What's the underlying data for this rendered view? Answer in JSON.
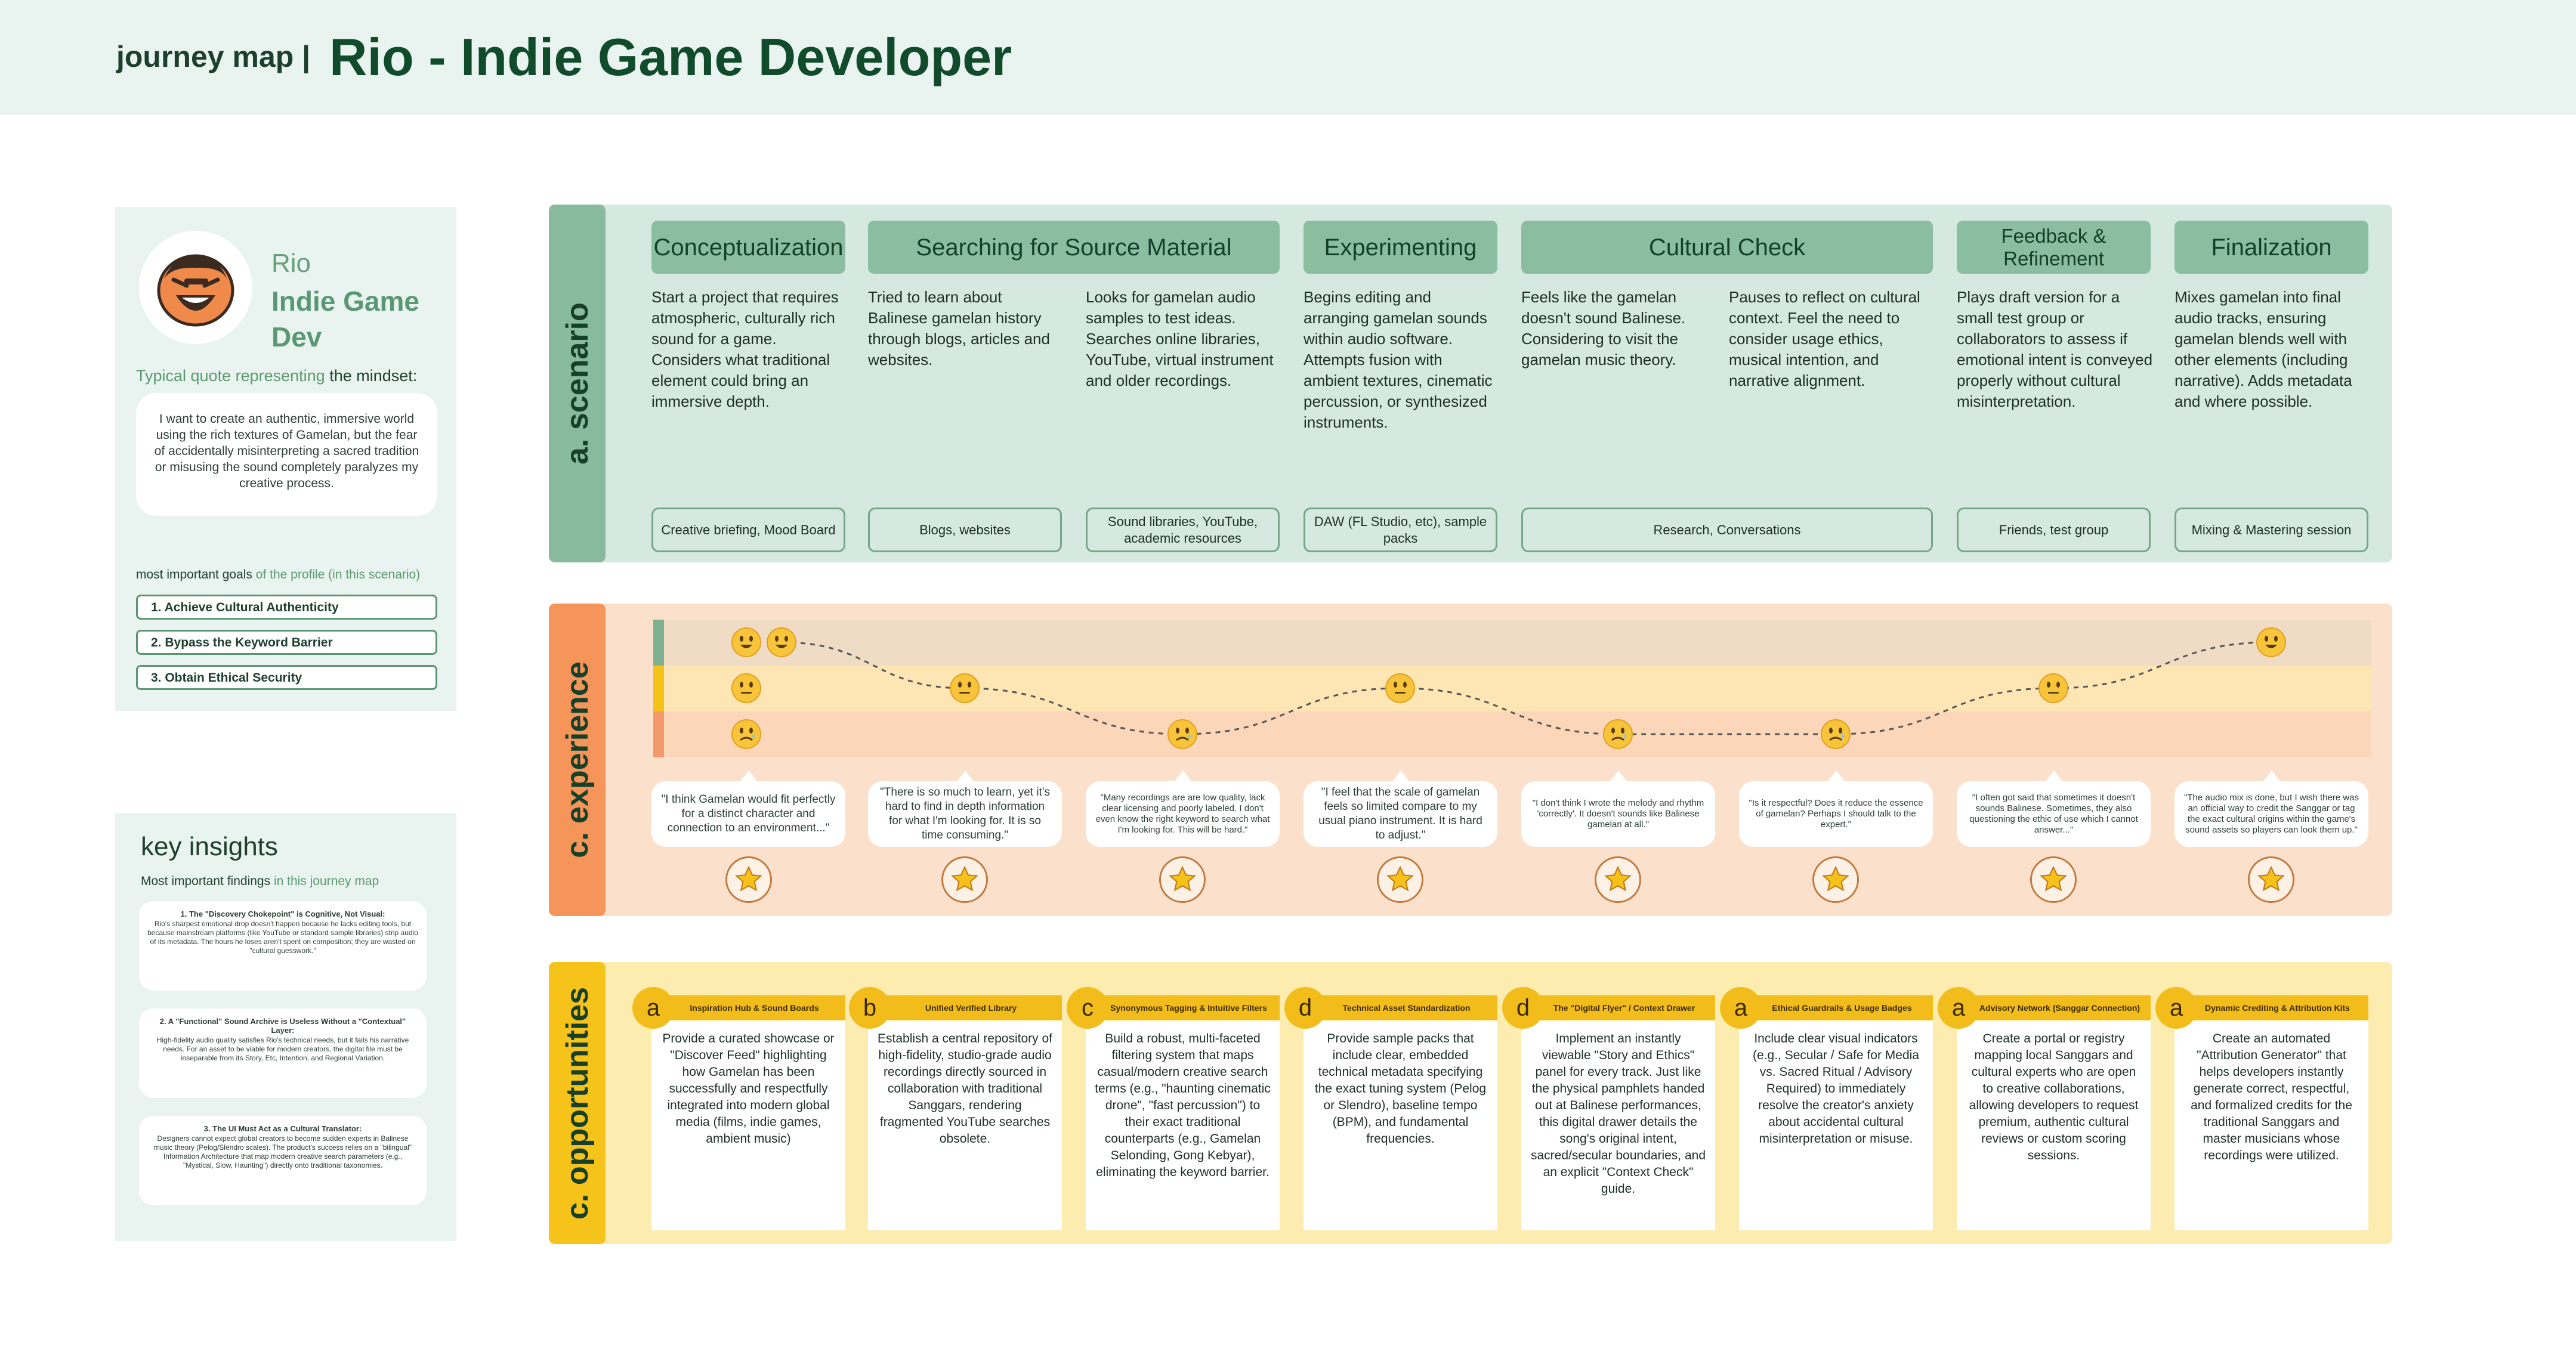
{
  "header": {
    "label": "journey map |",
    "title": "Rio - Indie Game Developer"
  },
  "persona": {
    "name": "Rio",
    "role": "Indie Game Dev",
    "quote_intro": "Typical quote representing",
    "quote_intro_b": "the mindset:",
    "quote": "I want to create an authentic, immersive world using the rich textures of Gamelan, but the fear of accidentally misinterpreting a sacred tradition or misusing the sound completely paralyzes my creative process.",
    "goals_intro": "most important goals",
    "goals_intro_b": "of the profile (in this scenario)",
    "goals": [
      "1. Achieve Cultural Authenticity",
      "2. Bypass the Keyword Barrier",
      "3. Obtain Ethical Security"
    ]
  },
  "insights": {
    "title": "key insights",
    "subtitle": "Most important findings",
    "subtitle_b": "in this journey map",
    "items": [
      {
        "heading": "1. The \"Discovery Chokepoint\" is Cognitive, Not Visual:",
        "body": "Rio's sharpest emotional drop doesn't happen because he lacks editing tools, but because mainstream platforms (like YouTube or standard sample libraries) strip audio of its metadata. The hours he loses aren't spent on composition; they are wasted on \"cultural guesswork.\""
      },
      {
        "heading": "2. A \"Functional\" Sound Archive is Useless Without a \"Contextual\" Layer:",
        "body": "High-fidelity audio quality satisfies Rio's technical needs, but it fails his narrative needs. For an asset to be viable for modern creators, the digital file must be inseparable from its Story, Etc, Intention, and Regional Variation."
      },
      {
        "heading": "3. The UI Must Act as a Cultural Translator:",
        "body": "Designers cannot expect global creators to become sudden experts in Balinese music theory (Pelog/Slendro scales). The product's success relies on a \"bilingual\" Information Architecture that map modern creative search parameters (e.g., \"Mystical, Slow, Haunting\") directly onto traditional taxonomies."
      }
    ]
  },
  "sections": {
    "scenario": "a. scenario",
    "experience": "c. experience",
    "opportunities": "c. opportunities"
  },
  "phases": [
    "Conceptualization",
    "Searching for Source Material",
    "Experimenting",
    "Cultural Check",
    "Feedback & Refinement",
    "Finalization"
  ],
  "scenario_texts": [
    "Start a project that requires atmospheric, culturally rich sound for a game. Considers what traditional element could bring an immersive depth.",
    "Tried to learn about Balinese gamelan history through blogs, articles and websites.",
    "Looks for gamelan audio samples to test ideas. Searches online libraries, YouTube, virtual instrument and older recordings.",
    "Begins editing and arranging gamelan sounds within audio software. Attempts fusion with ambient textures, cinematic percussion, or synthesized instruments.",
    "Feels like the gamelan doesn't sound Balinese. Considering to visit the gamelan music theory.",
    "Pauses to reflect on cultural context. Feel the need to consider usage ethics, musical intention, and narrative alignment.",
    "Plays draft version for a small test group or collaborators to assess if emotional intent is conveyed properly without cultural misinterpretation.",
    "Mixes gamelan into final audio tracks, ensuring gamelan blends well with other elements (including narrative). Adds metadata and where possible."
  ],
  "tools": [
    "Creative briefing, Mood Board",
    "Blogs, websites",
    "Sound libraries, YouTube, academic resources",
    "DAW (FL Studio, etc), sample packs",
    "Research, Conversations",
    "Friends, test group",
    "Mixing & Mastering session"
  ],
  "experience": {
    "levels": [
      3,
      2,
      1
    ],
    "points": [
      3,
      2,
      1,
      2,
      1,
      1,
      2,
      3
    ],
    "quotes": [
      "\"I think Gamelan would fit perfectly for a distinct character and connection to an environment...\"",
      "\"There is so much to learn, yet it's hard to find in depth information for what I'm looking for. It is so time consuming.\"",
      "\"Many recordings are are low quality, lack clear licensing and poorly labeled. I don't even know the right keyword to search what I'm looking for. This will be hard.\"",
      "\"I feel that the scale of gamelan feels so limited compare to my usual piano instrument. It is hard to adjust.\"",
      "\"I don't think I wrote the melody and rhythm 'correctly'. It doesn't sounds like Balinese gamelan at all.\"",
      "\"Is it respectful? Does it reduce the essence of gamelan? Perhaps I should talk to the expert.\"",
      "\"I often got said that sometimes it doesn't sounds Balinese. Sometimes, they also questioning the ethic of use which I cannot answer...\"",
      "\"The audio mix is done, but I wish there was an official way to credit the Sanggar or tag the exact cultural origins within the game's sound assets so players can look them up.\""
    ]
  },
  "opportunities": [
    {
      "badge": "a",
      "title": "Inspiration Hub & Sound Boards",
      "text": "Provide a curated showcase or \"Discover Feed\" highlighting how Gamelan has been successfully and respectfully integrated into modern global media (films, indie games, ambient music)"
    },
    {
      "badge": "b",
      "title": "Unified Verified Library",
      "text": "Establish a central repository of high-fidelity, studio-grade audio recordings directly sourced in collaboration with traditional Sanggars, rendering fragmented YouTube searches obsolete."
    },
    {
      "badge": "c",
      "title": "Synonymous Tagging & Intuitive Filters",
      "text": "Build a robust, multi-faceted filtering system that maps casual/modern creative search terms (e.g., \"haunting cinematic drone\", \"fast percussion\") to their exact traditional counterparts (e.g., Gamelan Selonding, Gong Kebyar), eliminating the keyword barrier."
    },
    {
      "badge": "d",
      "title": "Technical Asset Standardization",
      "text": "Provide sample packs that include clear, embedded technical metadata specifying the exact tuning system (Pelog or Slendro), baseline tempo (BPM), and fundamental frequencies."
    },
    {
      "badge": "d",
      "title": "The \"Digital Flyer\" / Context Drawer",
      "text": "Implement an instantly viewable \"Story and Ethics\" panel for every track. Just like the physical pamphlets handed out at Balinese performances, this digital drawer details the song's original intent, sacred/secular boundaries, and an explicit \"Context Check\" guide."
    },
    {
      "badge": "a",
      "title": "Ethical Guardrails & Usage Badges",
      "text": "Include clear visual indicators (e.g., Secular / Safe for Media vs. Sacred Ritual / Advisory Required) to immediately resolve the creator's anxiety about accidental cultural misinterpretation or misuse."
    },
    {
      "badge": "a",
      "title": "Advisory Network (Sanggar Connection)",
      "text": "Create a portal or registry mapping local Sanggars and cultural experts who are open to creative collaborations, allowing developers to request premium, authentic cultural reviews or custom scoring sessions."
    },
    {
      "badge": "a",
      "title": "Dynamic Crediting & Attribution Kits",
      "text": "Create an automated \"Attribution Generator\" that helps developers instantly generate correct, respectful, and formalized credits for the traditional Sanggars and master musicians whose recordings were utilized."
    }
  ],
  "colors": {
    "brand_green": "#104b2b",
    "scenario": "#88bb9e",
    "experience": "#f6955a",
    "opportunities": "#f6c31a"
  }
}
